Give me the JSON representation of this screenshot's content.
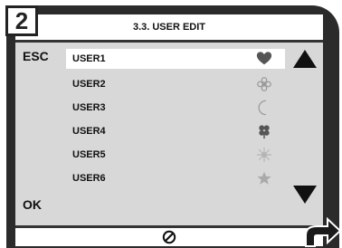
{
  "step": "2",
  "header": {
    "title": "3.3. USER EDIT"
  },
  "left_buttons": {
    "esc": "ESC",
    "ok": "OK"
  },
  "users": [
    {
      "label": "USER1",
      "icon": "heart-icon",
      "selected": true
    },
    {
      "label": "USER2",
      "icon": "flower-icon",
      "selected": false
    },
    {
      "label": "USER3",
      "icon": "moon-icon",
      "selected": false
    },
    {
      "label": "USER4",
      "icon": "clover-icon",
      "selected": false
    },
    {
      "label": "USER5",
      "icon": "sun-icon",
      "selected": false
    },
    {
      "label": "USER6",
      "icon": "star-icon",
      "selected": false
    }
  ],
  "nav": {
    "up_icon": "arrow-up-icon",
    "down_icon": "arrow-down-icon"
  },
  "footer": {
    "icon": "no-entry-icon"
  },
  "colors": {
    "frame": "#2b2b2b",
    "screen": "#d8d8d8",
    "selected_row": "#ffffff"
  }
}
